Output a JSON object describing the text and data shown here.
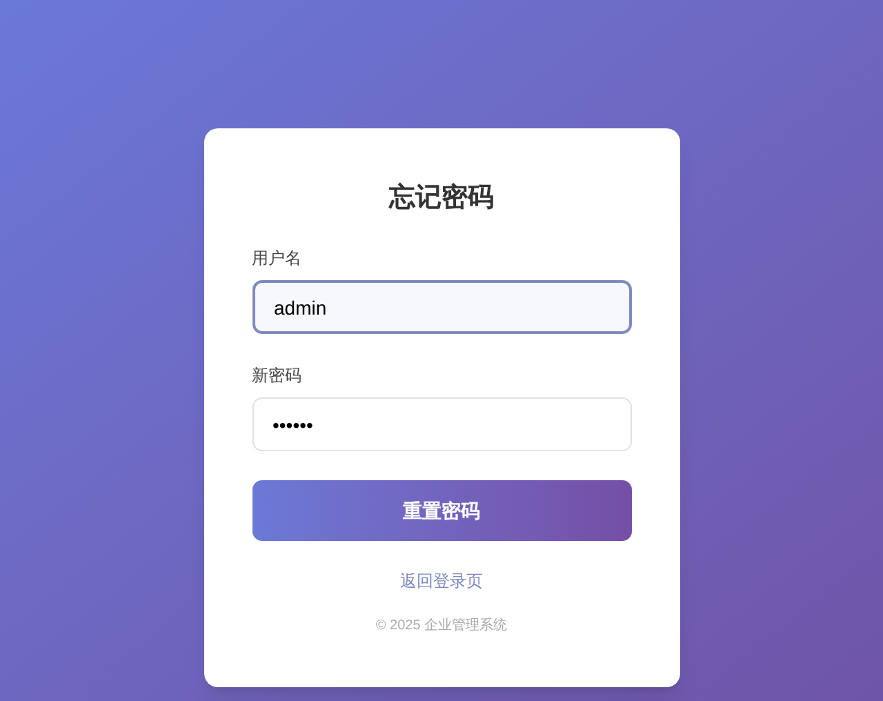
{
  "title": "忘记密码",
  "fields": [
    {
      "label": "用户名",
      "value": "admin",
      "focused": true
    },
    {
      "label": "新密码",
      "value": "••••••",
      "focused": false
    }
  ],
  "submit_button": "重置密码",
  "back_link": "返回登录页",
  "footer": "© 2025 企业管理系统"
}
